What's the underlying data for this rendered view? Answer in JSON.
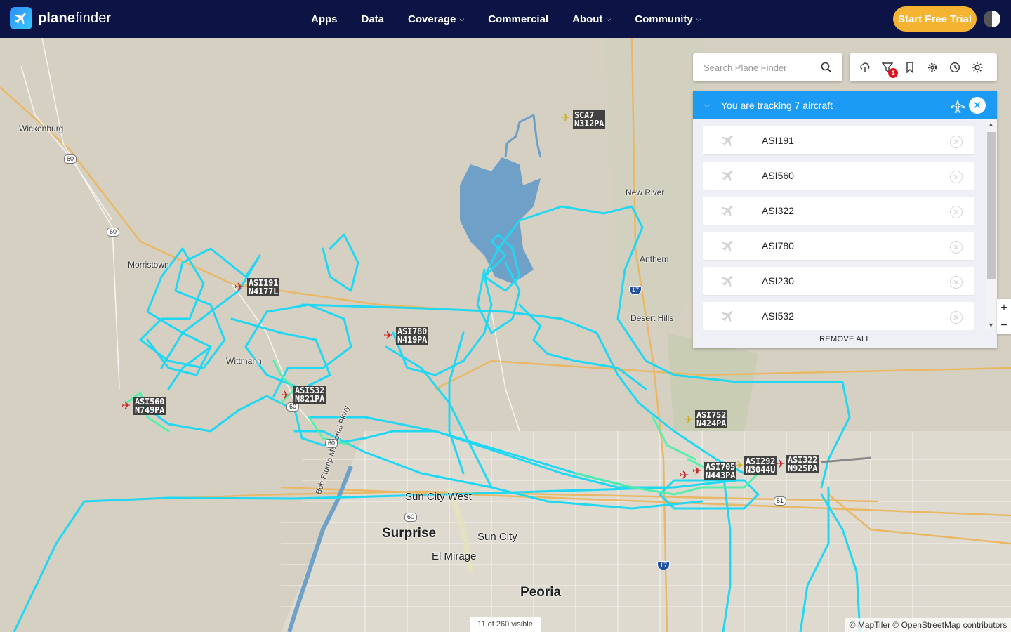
{
  "brand": {
    "name_bold": "plane",
    "name_rest": "finder"
  },
  "nav": [
    {
      "label": "Apps",
      "dropdown": false
    },
    {
      "label": "Data",
      "dropdown": false
    },
    {
      "label": "Coverage",
      "dropdown": true
    },
    {
      "label": "Commercial",
      "dropdown": false
    },
    {
      "label": "About",
      "dropdown": true
    },
    {
      "label": "Community",
      "dropdown": true
    }
  ],
  "header": {
    "trial_label": "Start Free Trial"
  },
  "search": {
    "placeholder": "Search Plane Finder"
  },
  "tools": {
    "icons": [
      "cloud-layer-icon",
      "filter-icon",
      "bookmark-icon",
      "settings-icon",
      "history-icon",
      "sun-icon"
    ],
    "filter_badge": "1"
  },
  "panel": {
    "title": "You are tracking 7 aircraft",
    "items": [
      "ASI191",
      "ASI560",
      "ASI322",
      "ASI780",
      "ASI230",
      "ASI532"
    ],
    "remove_all": "REMOVE ALL"
  },
  "map": {
    "places": {
      "wickenburg": "Wickenburg",
      "morristown": "Morristown",
      "wittmann": "Wittmann",
      "new_river": "New River",
      "anthem": "Anthem",
      "desert_hills": "Desert Hills",
      "sun_city_west": "Sun City West",
      "surprise": "Surprise",
      "sun_city": "Sun City",
      "el_mirage": "El Mirage",
      "peoria": "Peoria",
      "bob_stump": "Bob Stump Memorial Pkwy"
    },
    "shields": {
      "us60a": "60",
      "us60b": "60",
      "us60c": "60",
      "us60d": "60",
      "us60e": "60",
      "i17a": "17",
      "i17b": "17",
      "az51": "51"
    },
    "aircraft": [
      {
        "callsign": "SCA7",
        "reg": "N312PA",
        "color": "#c9b21d"
      },
      {
        "callsign": "ASI191",
        "reg": "N4177L",
        "color": "#c62828"
      },
      {
        "callsign": "ASI780",
        "reg": "N419PA",
        "color": "#c62828"
      },
      {
        "callsign": "ASI560",
        "reg": "N749PA",
        "color": "#c62828"
      },
      {
        "callsign": "ASI532",
        "reg": "N821PA",
        "color": "#c62828"
      },
      {
        "callsign": "ASI752",
        "reg": "N424PA",
        "color": "#c9b21d"
      },
      {
        "callsign": "ASI705",
        "reg": "N443PA",
        "color": "#c62828"
      },
      {
        "callsign": "ASI292",
        "reg": "N3044U",
        "color": "#c9b21d"
      },
      {
        "callsign": "ASI322",
        "reg": "N925PA",
        "color": "#c62828"
      }
    ],
    "visible_count": "11 of 260 visible",
    "attribution": "© MapTiler © OpenStreetMap contributors",
    "zoom_in": "+",
    "zoom_out": "−"
  },
  "colors": {
    "nav_bg": "#0b1445",
    "trial": "#f4b331",
    "panel_head": "#1b9bf4",
    "track": "#20d8f2",
    "track_alt": "#4ef0a8"
  }
}
